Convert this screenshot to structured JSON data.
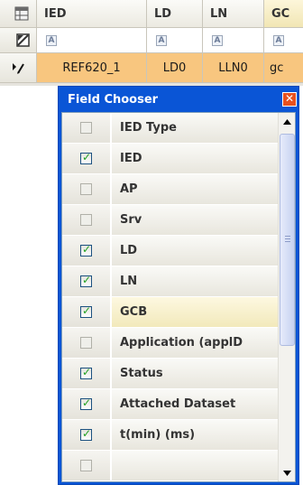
{
  "grid": {
    "columns": [
      "IED",
      "LD",
      "LN",
      "GC"
    ],
    "data_row": [
      "REF620_1",
      "LD0",
      "LLN0",
      "gc"
    ],
    "filter_glyph": "A",
    "icons": {
      "column_chooser": "field-chooser-icon",
      "filter_row": "filter-row-icon",
      "active_row": "edit-pencil-icon"
    },
    "row_highlight_color": "#f8c67f"
  },
  "chooser": {
    "title": "Field Chooser",
    "close_glyph": "✕",
    "fields": [
      {
        "label": "IED Type",
        "checked": false,
        "highlighted": false
      },
      {
        "label": "IED",
        "checked": true,
        "highlighted": false
      },
      {
        "label": "AP",
        "checked": false,
        "highlighted": false
      },
      {
        "label": "Srv",
        "checked": false,
        "highlighted": false
      },
      {
        "label": "LD",
        "checked": true,
        "highlighted": false
      },
      {
        "label": "LN",
        "checked": true,
        "highlighted": false
      },
      {
        "label": "GCB",
        "checked": true,
        "highlighted": true
      },
      {
        "label": "Application (applD",
        "checked": false,
        "highlighted": false
      },
      {
        "label": "Status",
        "checked": true,
        "highlighted": false
      },
      {
        "label": "Attached Dataset",
        "checked": true,
        "highlighted": false
      },
      {
        "label": "t(min) (ms)",
        "checked": true,
        "highlighted": false
      },
      {
        "label": "",
        "checked": false,
        "highlighted": false
      }
    ],
    "title_bar_color": "#0a55d6"
  }
}
